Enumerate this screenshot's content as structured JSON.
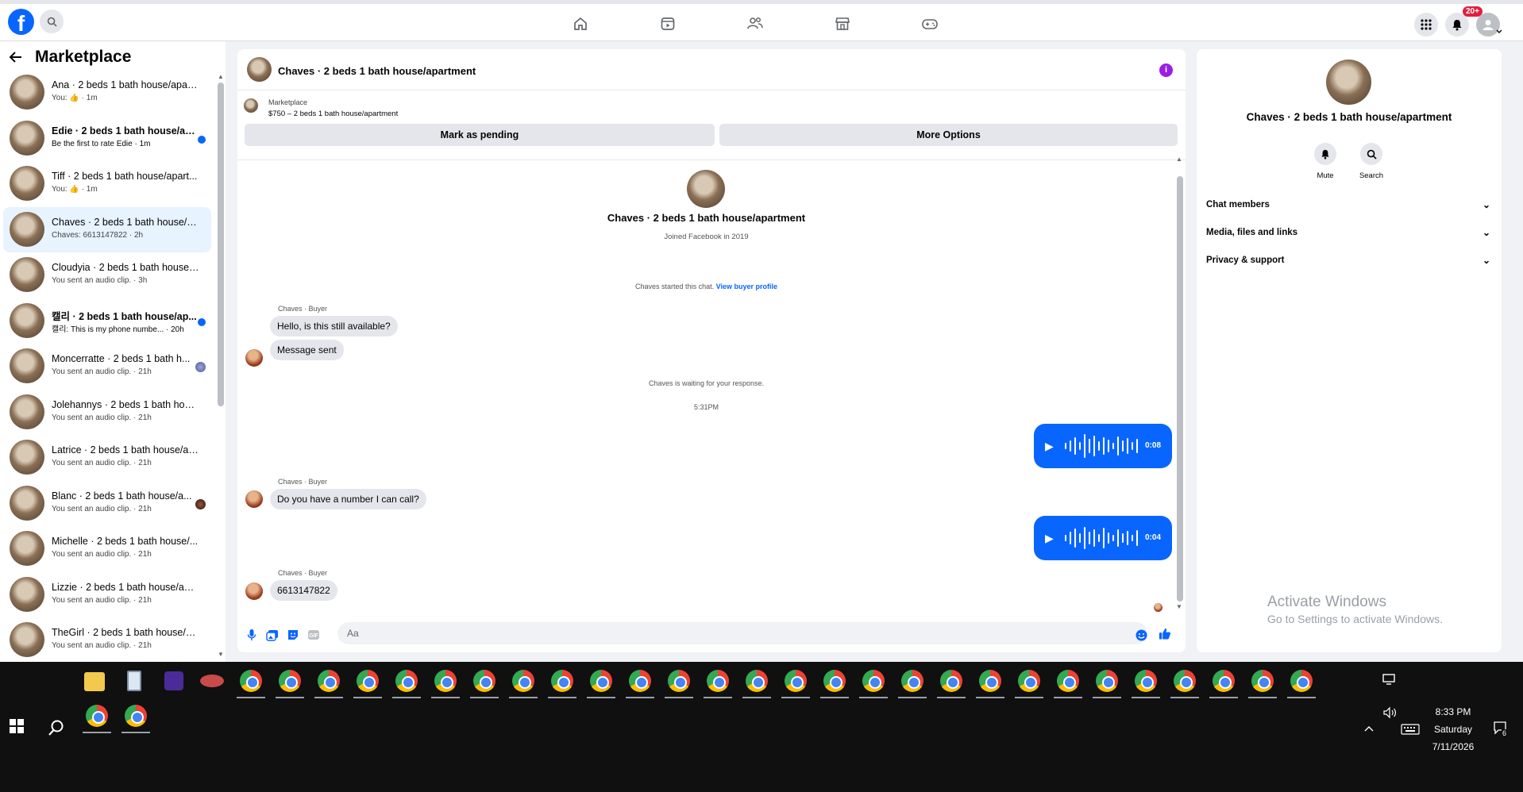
{
  "app": {
    "logo_letter": "f",
    "notification_count": "20+"
  },
  "sidebar": {
    "title": "Marketplace",
    "conversations": [
      {
        "name": "Ana · 2 beds 1 bath house/apart...",
        "snippet": "You: 👍 · 1m"
      },
      {
        "name": "Edie · 2 beds 1 bath house/ap...",
        "snippet": "Be the first to rate Edie · 1m"
      },
      {
        "name": "Tiff · 2 beds 1 bath house/apart...",
        "snippet": "You: 👍 · 1m"
      },
      {
        "name": "Chaves · 2 beds 1 bath house/a...",
        "snippet": "Chaves: 6613147822 · 2h"
      },
      {
        "name": "Cloudyia · 2 beds 1 bath house/...",
        "snippet": "You sent an audio clip. · 3h"
      },
      {
        "name": "캘리 · 2 beds 1 bath house/ap...",
        "snippet": "캘리: This is my phone numbe... · 20h"
      },
      {
        "name": "Moncerratte · 2 beds 1 bath h...",
        "snippet": "You sent an audio clip. · 21h"
      },
      {
        "name": "Jolehannys · 2 beds 1 bath hous...",
        "snippet": "You sent an audio clip. · 21h"
      },
      {
        "name": "Latrice · 2 beds 1 bath house/ap...",
        "snippet": "You sent an audio clip. · 21h"
      },
      {
        "name": "Blanc · 2 beds 1 bath house/a...",
        "snippet": "You sent an audio clip. · 21h"
      },
      {
        "name": "Michelle · 2 beds 1 bath house/...",
        "snippet": "You sent an audio clip. · 21h"
      },
      {
        "name": "Lizzie · 2 beds 1 bath house/apa...",
        "snippet": "You sent an audio clip. · 21h"
      },
      {
        "name": "TheGirl · 2 beds 1 bath house/a...",
        "snippet": "You sent an audio clip. · 21h"
      }
    ]
  },
  "chat": {
    "title": "Chaves · 2 beds 1 bath house/apartment",
    "listing_label": "Marketplace",
    "listing_price": "$750 – 2 beds 1 bath house/apartment",
    "mark_pending": "Mark as pending",
    "more_options": "More Options",
    "profile_name": "Chaves · 2 beds 1 bath house/apartment",
    "profile_sub": "Joined Facebook in 2019",
    "started_text": "Chaves started this chat.",
    "view_profile": "View buyer profile",
    "waiting_text": "Chaves is waiting for your response.",
    "time_divider": "5:31PM",
    "sender_label": "Chaves · Buyer",
    "msg1": "Hello, is this still available?",
    "msg2": "Message sent",
    "msg3": "Do you have a number I can call?",
    "msg4": "6613147822",
    "audio1_duration": "0:08",
    "audio2_duration": "0:04",
    "input_placeholder": "Aa"
  },
  "details": {
    "name": "Chaves · 2 beds 1 bath house/apartment",
    "mute": "Mute",
    "search": "Search",
    "sections": [
      "Chat members",
      "Media, files and links",
      "Privacy & support"
    ]
  },
  "watermark": {
    "line1": "Activate Windows",
    "line2": "Go to Settings to activate Windows."
  },
  "taskbar": {
    "time": "8:33 PM",
    "day": "Saturday",
    "date": "7/11/2026",
    "notif_count": "6"
  },
  "colors": {
    "accent": "#0866ff",
    "badge": "#e41e3f",
    "info": "#9b1ee6"
  }
}
